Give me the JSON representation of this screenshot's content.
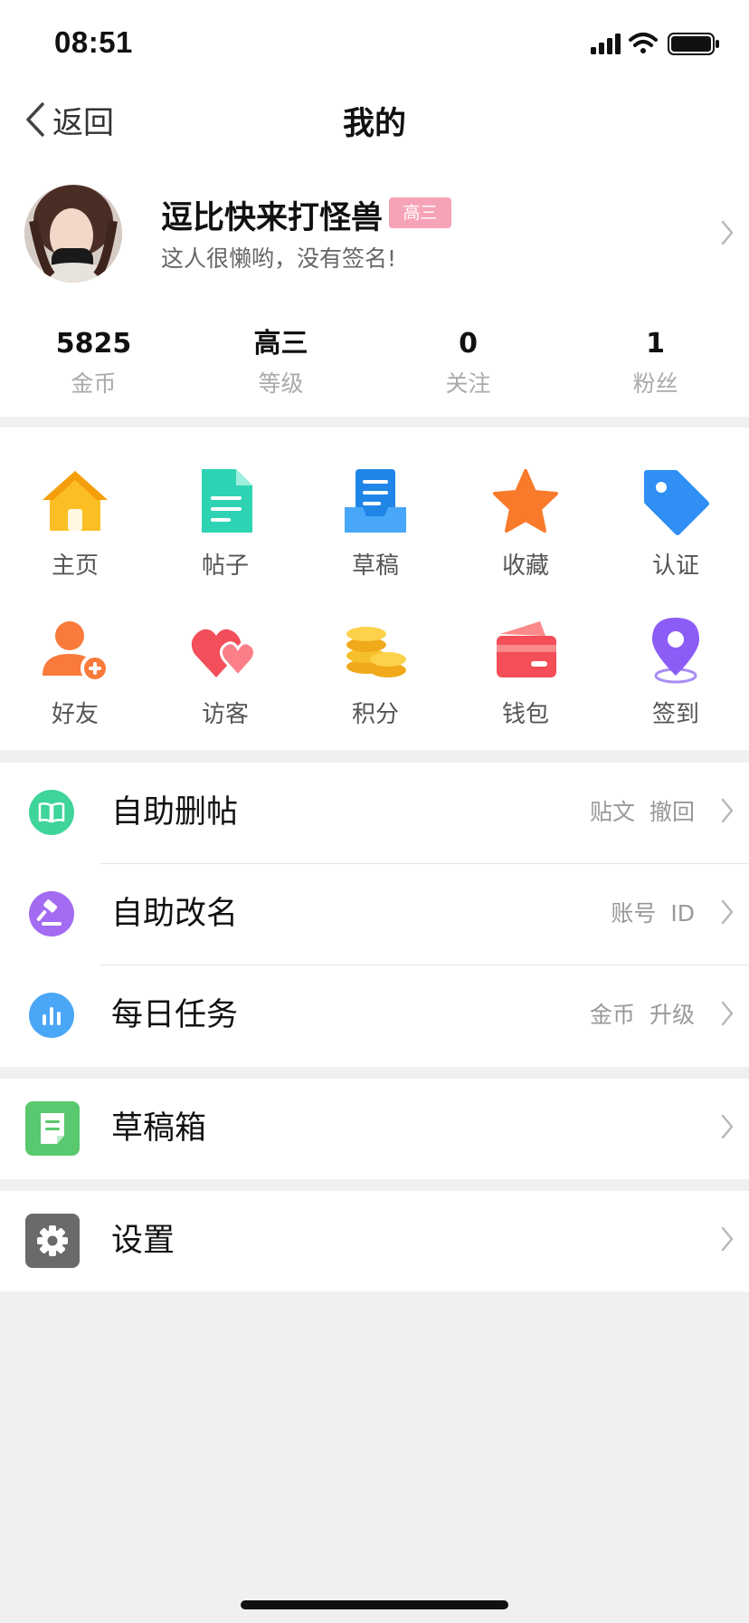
{
  "status_bar": {
    "time": "08:51"
  },
  "nav": {
    "back_label": "返回",
    "title": "我的"
  },
  "profile": {
    "username": "逗比快来打怪兽",
    "level_badge": "高三",
    "signature": "这人很懒哟，没有签名!"
  },
  "stats": [
    {
      "value": "5825",
      "label": "金币"
    },
    {
      "value": "高三",
      "label": "等级"
    },
    {
      "value": "0",
      "label": "关注"
    },
    {
      "value": "1",
      "label": "粉丝"
    }
  ],
  "grid": [
    {
      "label": "主页",
      "icon": "home-icon"
    },
    {
      "label": "帖子",
      "icon": "document-icon"
    },
    {
      "label": "草稿",
      "icon": "draft-tray-icon"
    },
    {
      "label": "收藏",
      "icon": "star-icon"
    },
    {
      "label": "认证",
      "icon": "tag-icon"
    },
    {
      "label": "好友",
      "icon": "add-friend-icon"
    },
    {
      "label": "访客",
      "icon": "hearts-icon"
    },
    {
      "label": "积分",
      "icon": "coins-icon"
    },
    {
      "label": "钱包",
      "icon": "wallet-icon"
    },
    {
      "label": "签到",
      "icon": "location-pin-icon"
    }
  ],
  "tools": [
    {
      "label": "自助删帖",
      "hint": "贴文 撤回",
      "icon": "book-icon",
      "color": "#3ed49a"
    },
    {
      "label": "自助改名",
      "hint": "账号 ID",
      "icon": "gavel-icon",
      "color": "#a36bf2"
    },
    {
      "label": "每日任务",
      "hint": "金币 升级",
      "icon": "bar-chart-icon",
      "color": "#4aa6f7"
    }
  ],
  "drafts_row": {
    "label": "草稿箱",
    "icon": "draft-box-icon",
    "color": "#5ac86e"
  },
  "settings_row": {
    "label": "设置",
    "icon": "gear-icon",
    "color": "#6a6a6a"
  },
  "colors": {
    "badge": "#f6a3b8",
    "background": "#f0f0f0"
  }
}
